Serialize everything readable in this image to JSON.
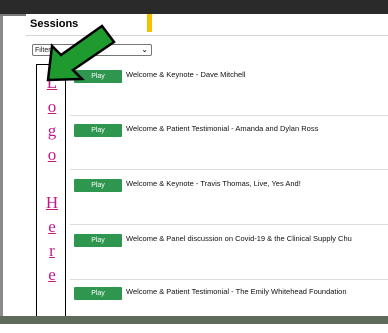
{
  "panel": {
    "title": "Sessions",
    "filter": {
      "selected": "Filter"
    }
  },
  "logo": {
    "letters": [
      "L",
      "o",
      "g",
      "o",
      "H",
      "e",
      "r",
      "e"
    ]
  },
  "sessions": [
    {
      "button": "Play",
      "title": "Welcome & Keynote - Dave Mitchell"
    },
    {
      "button": "Play",
      "title": "Welcome & Patient Testimonial - Amanda and Dylan Ross"
    },
    {
      "button": "Play",
      "title": "Welcome & Keynote - Travis Thomas, Live, Yes And!"
    },
    {
      "button": "Play",
      "title": "Welcome & Panel discussion on Covid-19 & the Clinical Supply Chu"
    },
    {
      "button": "Play",
      "title": "Welcome & Patient Testimonial - The Emily Whitehead Foundation"
    }
  ],
  "colors": {
    "accent_green": "#2f9650",
    "logo_pink": "#c4188a",
    "arrow_green": "#1f9a2e"
  },
  "icons": {
    "annotation_arrow": "green-arrow-icon",
    "dropdown": "chevron-down-icon"
  }
}
